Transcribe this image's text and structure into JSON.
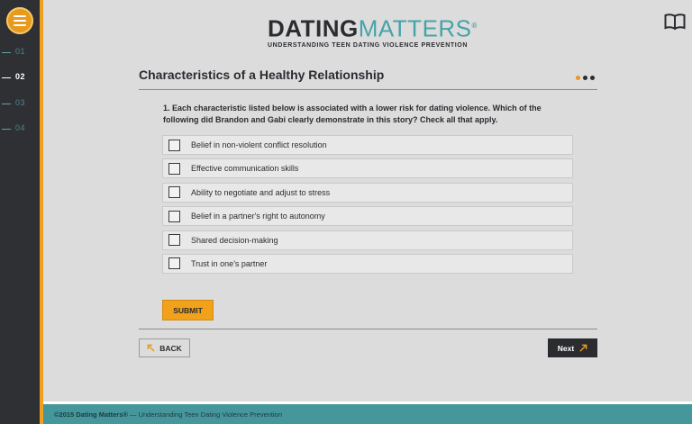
{
  "header": {
    "logo_primary": "DATING",
    "logo_secondary": "MATTERS",
    "logo_registered": "®",
    "logo_tagline": "UNDERSTANDING TEEN DATING VIOLENCE PREVENTION",
    "resource_icon": "book-icon"
  },
  "sidebar": {
    "menu_icon": "hamburger-icon",
    "items": [
      {
        "label": "01",
        "active": false
      },
      {
        "label": "02",
        "active": true
      },
      {
        "label": "03",
        "active": false
      },
      {
        "label": "04",
        "active": false
      }
    ]
  },
  "page": {
    "title": "Characteristics of a Healthy Relationship",
    "progress_dots": 3,
    "active_dot": 1
  },
  "question": {
    "text": "1. Each characteristic listed below is associated with a lower risk for dating violence. Which of the following did Brandon and Gabi clearly demonstrate in this story? Check all that apply.",
    "options": [
      {
        "label": "Belief in non-violent conflict resolution",
        "checked": false
      },
      {
        "label": "Effective communication skills",
        "checked": false
      },
      {
        "label": "Ability to negotiate and adjust to stress",
        "checked": false
      },
      {
        "label": "Belief in a partner's right to autonomy",
        "checked": false
      },
      {
        "label": "Shared decision-making",
        "checked": false
      },
      {
        "label": "Trust in one's partner",
        "checked": false
      }
    ],
    "submit_label": "SUBMIT"
  },
  "navigation": {
    "back_label": "BACK",
    "next_label": "Next"
  },
  "footer": {
    "copyright": "©2015 Dating Matters®",
    "separator": " — ",
    "tagline": "Understanding Teen Dating Violence Prevention"
  },
  "colors": {
    "accent": "#f0a01e",
    "teal": "#45979b",
    "dark": "#2a2c30",
    "background": "#dcdcdc"
  }
}
